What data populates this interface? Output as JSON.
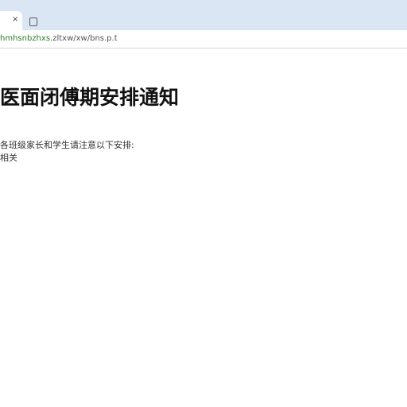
{
  "browser": {
    "tab_close_glyph": "×",
    "address": {
      "host": "hmhsnbzhxs.",
      "path": "zltxw/xw/bns.p.t"
    }
  },
  "page": {
    "title": "医面闭傅期安排通知",
    "lines": [
      "各班级家长和学生请注意以下安排:",
      "相关"
    ]
  }
}
